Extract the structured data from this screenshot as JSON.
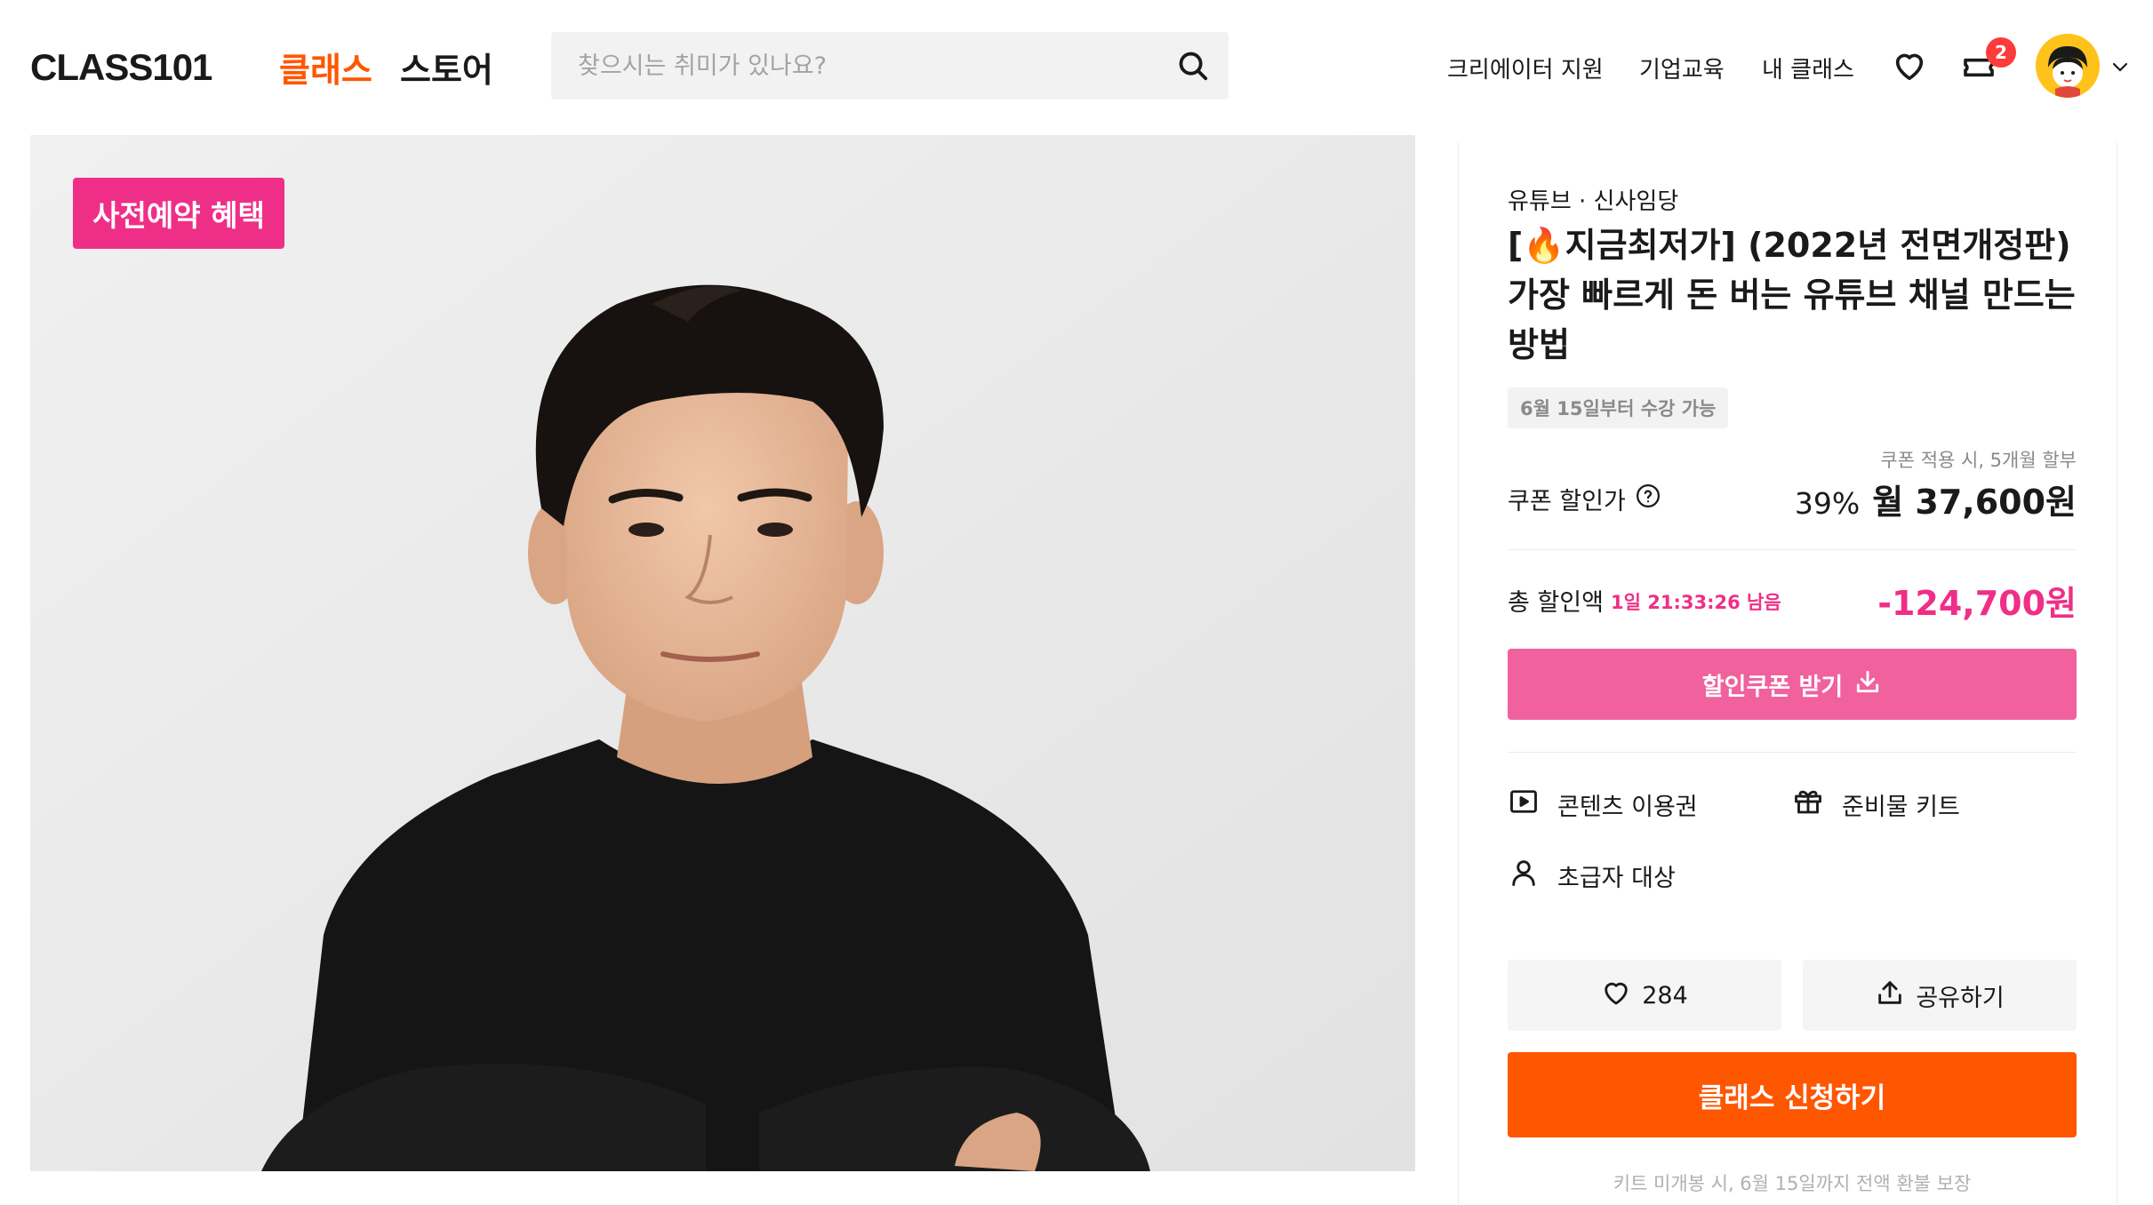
{
  "header": {
    "logo": "CLASS101",
    "nav_class": "클래스",
    "nav_store": "스토어",
    "search_placeholder": "찾으시는 취미가 있나요?",
    "creator_support": "크리에이터 지원",
    "enterprise": "기업교육",
    "my_class": "내 클래스",
    "cart_count": "2"
  },
  "hero": {
    "promo_badge": "사전예약 혜택"
  },
  "product": {
    "category": "유튜브 · 신사임당",
    "title": "[🔥지금최저가] (2022년 전면개정판) 가장 빠르게 돈 버는 유튜브 채널 만드는 방법",
    "availability": "6월 15일부터 수강 가능",
    "installment_note": "쿠폰 적용 시, 5개월 할부",
    "coupon_price_label": "쿠폰 할인가",
    "discount_percent": "39%",
    "monthly_price": "월 37,600원",
    "total_discount_label": "총 할인액",
    "timer": "1일 21:33:26 남음",
    "total_discount": "-124,700원",
    "coupon_button": "할인쿠폰 받기",
    "features": [
      {
        "icon": "play-icon",
        "label": "콘텐츠 이용권"
      },
      {
        "icon": "gift-icon",
        "label": "준비물 키트"
      },
      {
        "icon": "person-icon",
        "label": "초급자 대상"
      }
    ],
    "like_count": "284",
    "share_label": "공유하기",
    "apply_button": "클래스 신청하기",
    "refund_note": "키트 미개봉 시, 6월 15일까지 전액 환불 보장"
  },
  "colors": {
    "brand_orange": "#ff5600",
    "promo_pink": "#ef2f87",
    "coupon_pink": "#f0619e"
  }
}
